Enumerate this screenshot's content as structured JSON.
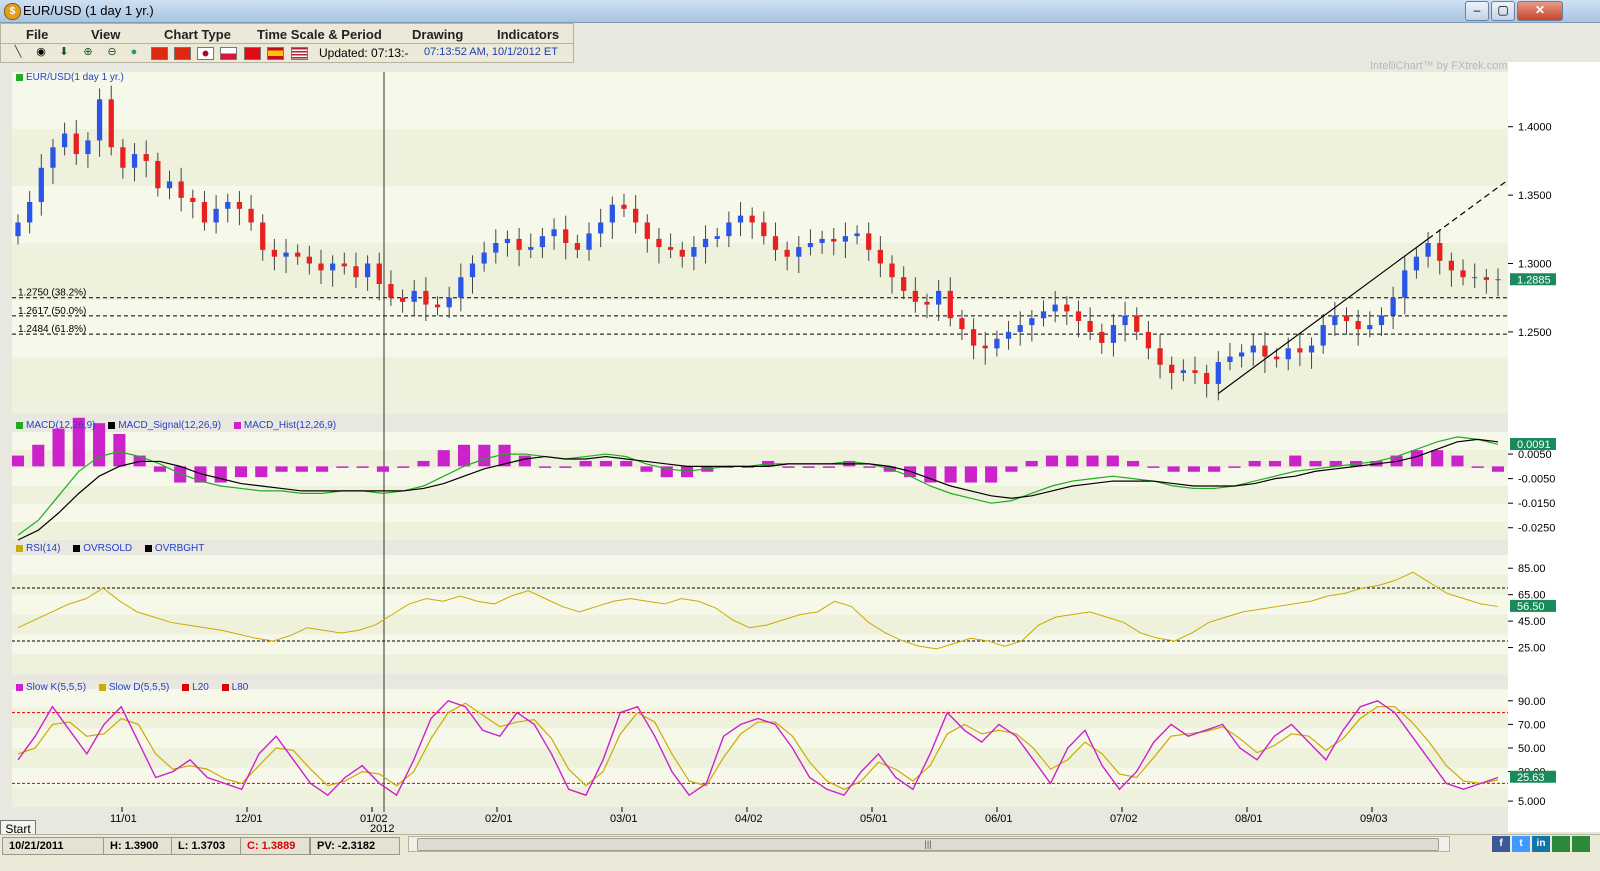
{
  "window": {
    "title": "EUR/USD (1 day  1 yr.)",
    "buttons": [
      "–",
      "▢",
      "✕"
    ]
  },
  "menu": [
    "File",
    "View",
    "Chart Type",
    "Time Scale & Period",
    "Drawing",
    "Indicators"
  ],
  "toolbar": {
    "updated_label": "Updated: 07:13:-",
    "updated_time": "07:13:52 AM, 10/1/2012 ET",
    "icons": [
      "line-tool-icon",
      "crosshair-icon",
      "arrow-down-icon",
      "zoom-in-icon",
      "zoom-out-icon",
      "pin-icon"
    ],
    "flags": [
      "china-flag",
      "hongkong-flag",
      "japan-flag",
      "poland-flag",
      "turkey-flag",
      "spain-flag",
      "usa-flag"
    ]
  },
  "watermark": "IntelliChart™ by FXtrek.com",
  "chart_data": [
    {
      "type": "candlestick",
      "title": "EUR/USD(1 day  1 yr.)",
      "x_ticks": [
        "11/01",
        "12/01",
        "01/02",
        "02/01",
        "03/01",
        "04/02",
        "05/01",
        "06/01",
        "07/02",
        "08/01",
        "09/03"
      ],
      "x_year_label": "2012",
      "y_ticks": [
        "1.4000",
        "1.3500",
        "1.3000",
        "1.2500"
      ],
      "ylim": [
        1.19,
        1.44
      ],
      "last_price": "1.2885",
      "fib_levels": [
        {
          "label": "1.2750 (38.2%)",
          "value": 1.275
        },
        {
          "label": "1.2617 (50.0%)",
          "value": 1.2617
        },
        {
          "label": "1.2484 (61.8%)",
          "value": 1.2484
        }
      ],
      "closes": [
        1.33,
        1.345,
        1.37,
        1.385,
        1.395,
        1.38,
        1.39,
        1.42,
        1.385,
        1.37,
        1.38,
        1.375,
        1.355,
        1.36,
        1.348,
        1.345,
        1.33,
        1.34,
        1.345,
        1.34,
        1.33,
        1.31,
        1.305,
        1.308,
        1.305,
        1.3,
        1.295,
        1.3,
        1.298,
        1.29,
        1.3,
        1.285,
        1.275,
        1.272,
        1.28,
        1.27,
        1.268,
        1.275,
        1.29,
        1.3,
        1.308,
        1.315,
        1.318,
        1.31,
        1.312,
        1.32,
        1.325,
        1.315,
        1.31,
        1.322,
        1.33,
        1.343,
        1.34,
        1.33,
        1.318,
        1.312,
        1.31,
        1.305,
        1.312,
        1.318,
        1.32,
        1.33,
        1.335,
        1.33,
        1.32,
        1.31,
        1.305,
        1.312,
        1.315,
        1.318,
        1.316,
        1.32,
        1.322,
        1.31,
        1.3,
        1.29,
        1.28,
        1.272,
        1.27,
        1.28,
        1.26,
        1.252,
        1.24,
        1.238,
        1.245,
        1.25,
        1.255,
        1.26,
        1.265,
        1.27,
        1.265,
        1.258,
        1.25,
        1.242,
        1.255,
        1.262,
        1.25,
        1.238,
        1.226,
        1.22,
        1.222,
        1.22,
        1.212,
        1.228,
        1.232,
        1.235,
        1.24,
        1.232,
        1.23,
        1.238,
        1.235,
        1.24,
        1.255,
        1.262,
        1.258,
        1.252,
        1.255,
        1.262,
        1.275,
        1.295,
        1.305,
        1.315,
        1.302,
        1.295,
        1.29,
        1.29,
        1.288,
        1.2885
      ]
    },
    {
      "type": "line",
      "title": "MACD",
      "series_names": [
        "MACD(12,26,9)",
        "MACD_Signal(12,26,9)",
        "MACD_Hist(12,26,9)"
      ],
      "y_ticks": [
        "0.0050",
        "-0.0050",
        "-0.0150",
        "-0.0250"
      ],
      "ylim": [
        -0.03,
        0.014
      ],
      "last_value": "0.0091",
      "macd": [
        -0.028,
        -0.022,
        -0.012,
        -0.002,
        0.004,
        0.006,
        0.004,
        0.001,
        -0.003,
        -0.006,
        -0.008,
        -0.009,
        -0.01,
        -0.01,
        -0.011,
        -0.011,
        -0.01,
        -0.01,
        -0.011,
        -0.01,
        -0.008,
        -0.004,
        0.0,
        0.003,
        0.005,
        0.005,
        0.004,
        0.003,
        0.004,
        0.005,
        0.004,
        0.001,
        -0.001,
        -0.002,
        -0.001,
        0.0,
        0.0,
        0.001,
        0.001,
        0.001,
        0.001,
        0.002,
        0.001,
        -0.001,
        -0.004,
        -0.008,
        -0.011,
        -0.013,
        -0.015,
        -0.014,
        -0.011,
        -0.008,
        -0.006,
        -0.005,
        -0.004,
        -0.005,
        -0.006,
        -0.008,
        -0.009,
        -0.009,
        -0.008,
        -0.006,
        -0.004,
        -0.002,
        -0.001,
        0.0,
        0.001,
        0.002,
        0.004,
        0.007,
        0.01,
        0.012,
        0.011,
        0.009
      ],
      "signal": [
        -0.03,
        -0.026,
        -0.019,
        -0.011,
        -0.004,
        0.0,
        0.002,
        0.002,
        0.0,
        -0.003,
        -0.005,
        -0.007,
        -0.008,
        -0.009,
        -0.01,
        -0.01,
        -0.01,
        -0.01,
        -0.01,
        -0.01,
        -0.009,
        -0.007,
        -0.004,
        -0.001,
        0.001,
        0.003,
        0.004,
        0.003,
        0.003,
        0.004,
        0.003,
        0.002,
        0.001,
        0.0,
        0.0,
        0.0,
        0.0,
        0.0,
        0.001,
        0.001,
        0.001,
        0.001,
        0.001,
        0.0,
        -0.002,
        -0.005,
        -0.008,
        -0.01,
        -0.012,
        -0.013,
        -0.012,
        -0.01,
        -0.008,
        -0.007,
        -0.006,
        -0.006,
        -0.006,
        -0.007,
        -0.008,
        -0.008,
        -0.008,
        -0.007,
        -0.005,
        -0.004,
        -0.002,
        -0.001,
        0.0,
        0.001,
        0.002,
        0.004,
        0.007,
        0.01,
        0.011,
        0.01
      ]
    },
    {
      "type": "line",
      "title": "RSI",
      "series_names": [
        "RSI(14)",
        "OVRSOLD",
        "OVRBGHT"
      ],
      "y_ticks": [
        "85.00",
        "65.00",
        "45.00",
        "25.00"
      ],
      "ylim": [
        5,
        95
      ],
      "overbought": 70,
      "oversold": 30,
      "last_value": "56.50",
      "values": [
        40,
        46,
        52,
        58,
        62,
        70,
        60,
        52,
        48,
        44,
        42,
        40,
        38,
        35,
        32,
        30,
        34,
        40,
        38,
        36,
        38,
        42,
        50,
        58,
        62,
        60,
        64,
        60,
        58,
        64,
        68,
        62,
        56,
        52,
        56,
        60,
        62,
        60,
        58,
        62,
        60,
        55,
        46,
        40,
        42,
        46,
        50,
        52,
        60,
        56,
        44,
        36,
        30,
        26,
        24,
        28,
        32,
        30,
        26,
        30,
        42,
        48,
        50,
        52,
        48,
        44,
        36,
        32,
        30,
        36,
        44,
        48,
        52,
        54,
        56,
        58,
        60,
        64,
        66,
        70,
        72,
        76,
        82,
        74,
        66,
        62,
        58,
        56
      ]
    },
    {
      "type": "line",
      "title": "Stochastic",
      "series_names": [
        "Slow K(5,5,5)",
        "Slow D(5,5,5)",
        "L20",
        "L80"
      ],
      "y_ticks": [
        "90.00",
        "70.00",
        "50.00",
        "30.00",
        "5.000"
      ],
      "ylim": [
        0,
        100
      ],
      "upper": 80,
      "lower": 20,
      "last_value": "25.63",
      "slow_k": [
        40,
        60,
        85,
        65,
        45,
        70,
        85,
        55,
        25,
        30,
        40,
        25,
        20,
        15,
        45,
        60,
        40,
        20,
        10,
        25,
        35,
        20,
        10,
        40,
        75,
        90,
        85,
        65,
        60,
        80,
        70,
        45,
        15,
        10,
        40,
        80,
        85,
        60,
        30,
        10,
        20,
        60,
        70,
        75,
        70,
        50,
        25,
        15,
        10,
        30,
        45,
        25,
        15,
        45,
        80,
        65,
        55,
        70,
        60,
        40,
        20,
        50,
        65,
        35,
        15,
        30,
        55,
        70,
        60,
        65,
        70,
        50,
        40,
        60,
        70,
        55,
        40,
        65,
        85,
        90,
        80,
        60,
        40,
        20,
        15,
        20,
        25
      ],
      "slow_d": [
        45,
        50,
        70,
        72,
        60,
        62,
        75,
        70,
        45,
        32,
        35,
        32,
        24,
        20,
        35,
        50,
        48,
        32,
        18,
        22,
        30,
        28,
        18,
        30,
        58,
        80,
        88,
        78,
        68,
        72,
        74,
        58,
        32,
        18,
        30,
        62,
        80,
        72,
        45,
        22,
        18,
        42,
        62,
        72,
        72,
        60,
        38,
        22,
        15,
        22,
        38,
        32,
        22,
        35,
        62,
        70,
        62,
        65,
        62,
        50,
        32,
        40,
        55,
        45,
        28,
        25,
        42,
        60,
        62,
        64,
        68,
        58,
        46,
        52,
        62,
        60,
        48,
        58,
        75,
        85,
        85,
        72,
        55,
        35,
        22,
        20,
        23
      ]
    }
  ],
  "legends": {
    "price": [
      {
        "label": "EUR/USD(1 day  1 yr.)",
        "color": "#22aa22"
      }
    ],
    "macd": [
      {
        "label": "MACD(12,26,9)",
        "color": "#22aa22"
      },
      {
        "label": "MACD_Signal(12,26,9)",
        "color": "#000000"
      },
      {
        "label": "MACD_Hist(12,26,9)",
        "color": "#cc22cc"
      }
    ],
    "rsi": [
      {
        "label": "RSI(14)",
        "color": "#ccaa00"
      },
      {
        "label": "OVRSOLD",
        "color": "#000000"
      },
      {
        "label": "OVRBGHT",
        "color": "#000000"
      }
    ],
    "stoch": [
      {
        "label": "Slow K(5,5,5)",
        "color": "#cc22cc"
      },
      {
        "label": "Slow D(5,5,5)",
        "color": "#ccaa00"
      },
      {
        "label": "L20",
        "color": "#dd0000"
      },
      {
        "label": "L80",
        "color": "#dd0000"
      }
    ]
  },
  "status": {
    "start": "Start",
    "date": "10/21/2011",
    "high": "H: 1.3900",
    "low": "L: 1.3703",
    "close": "C: 1.3889",
    "pv": "PV: -2.3182",
    "scroll_grip": "|||"
  },
  "social_icons": [
    "f",
    "t",
    "in",
    "",
    ""
  ]
}
